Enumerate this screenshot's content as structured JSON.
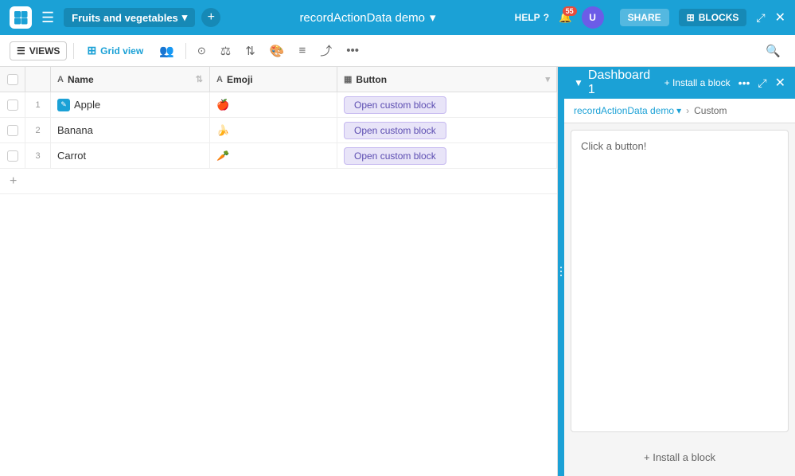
{
  "topbar": {
    "app_title": "recordActionData demo",
    "dropdown_caret": "▾",
    "base_name": "Fruits and vegetables",
    "help_label": "HELP",
    "notif_count": "55",
    "avatar_initials": "U"
  },
  "secondary_toolbar": {
    "views_label": "VIEWS",
    "grid_view_label": "Grid view"
  },
  "table": {
    "columns": [
      {
        "label": "Name",
        "type": "text",
        "type_icon": "A"
      },
      {
        "label": "Emoji",
        "type": "text",
        "type_icon": "A"
      },
      {
        "label": "Button",
        "type": "button",
        "type_icon": "▦"
      }
    ],
    "rows": [
      {
        "num": "1",
        "name": "Apple",
        "emoji": "🍎",
        "button_label": "Open custom block",
        "has_icon": true
      },
      {
        "num": "2",
        "name": "Banana",
        "emoji": "🍌",
        "button_label": "Open custom block",
        "has_icon": false
      },
      {
        "num": "3",
        "name": "Carrot",
        "emoji": "🥕",
        "button_label": "Open custom block",
        "has_icon": false
      }
    ],
    "add_row_label": "+"
  },
  "right_panel": {
    "chevron": "▼",
    "dashboard_title": "Dashboard 1",
    "install_btn_label": "+ Install a block",
    "more_icon": "•••",
    "maximize_icon": "⤢",
    "close_icon": "✕",
    "source_label": "recordActionData demo",
    "source_caret": "▾",
    "type_label": "Custom",
    "content_text": "Click a button!",
    "install_bottom_label": "+ Install a block"
  },
  "blocks_tab": {
    "icon": "⊞",
    "label": "BLOCKS"
  },
  "resize_dots": [
    "•",
    "•",
    "•"
  ]
}
